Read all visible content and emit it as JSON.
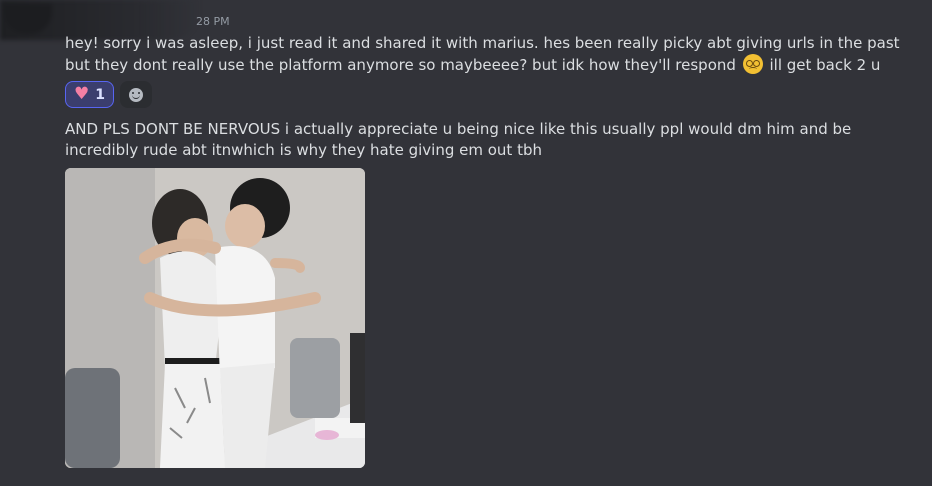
{
  "header": {
    "timestamp": "28 PM"
  },
  "messages": [
    {
      "text_before_emoji": "hey! sorry i was asleep, i just read it and shared it with marius. hes been really picky abt giving urls in the past but they dont really use the platform anymore so maybeeee? but idk how they'll respond",
      "emoji_icon": "woozy-face-emoji",
      "text_after_emoji": " ill get back 2 u"
    },
    {
      "text": "AND PLS DONT BE NERVOUS i actually appreciate u being nice like this usually ppl would dm him and be incredibly rude abt itnwhich is why they hate giving em out tbh"
    }
  ],
  "reactions": [
    {
      "icon": "heart-icon",
      "count": "1"
    }
  ],
  "add_reaction_icon": "add-reaction-icon",
  "attachment": {
    "kind": "image",
    "icon": "photo-two-people-hugging"
  }
}
